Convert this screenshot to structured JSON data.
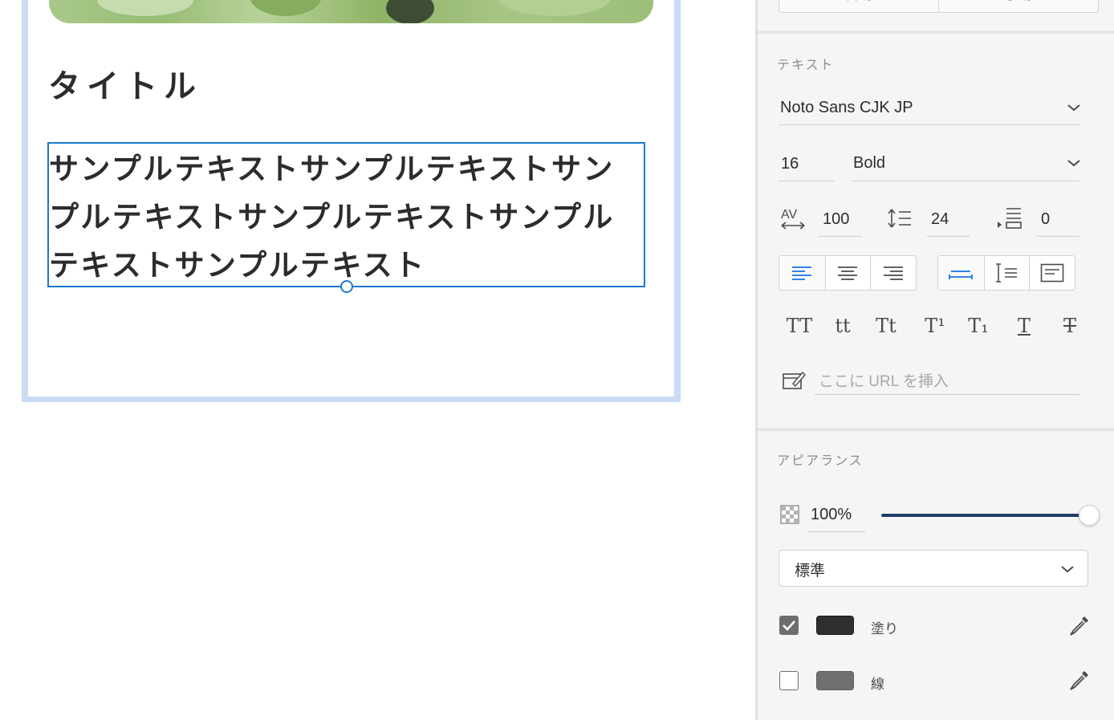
{
  "canvas": {
    "title": "タイトル",
    "body_text": "サンプルテキストサンプルテキストサンプルテキストサンプルテキストサンプルテキストサンプルテキスト"
  },
  "panel": {
    "top_tabs": [
      "自動",
      "手動"
    ],
    "text_section": {
      "label": "テキスト",
      "font_family": "Noto Sans CJK JP",
      "font_size": "16",
      "font_weight": "Bold",
      "letter_spacing": "100",
      "line_height": "24",
      "paragraph_spacing": "0",
      "style_buttons": [
        "TT",
        "tt",
        "Tt",
        "T¹",
        "T₁",
        "T",
        "T"
      ],
      "url_placeholder": "ここに URL を挿入"
    },
    "appearance_section": {
      "label": "アピアランス",
      "opacity": "100%",
      "opacity_level": 1.0,
      "blend_mode": "標準",
      "fill": {
        "label": "塗り",
        "checked": true,
        "color": "#2f2f2f"
      },
      "stroke": {
        "label": "線",
        "checked": false,
        "color": "#707070"
      }
    }
  }
}
